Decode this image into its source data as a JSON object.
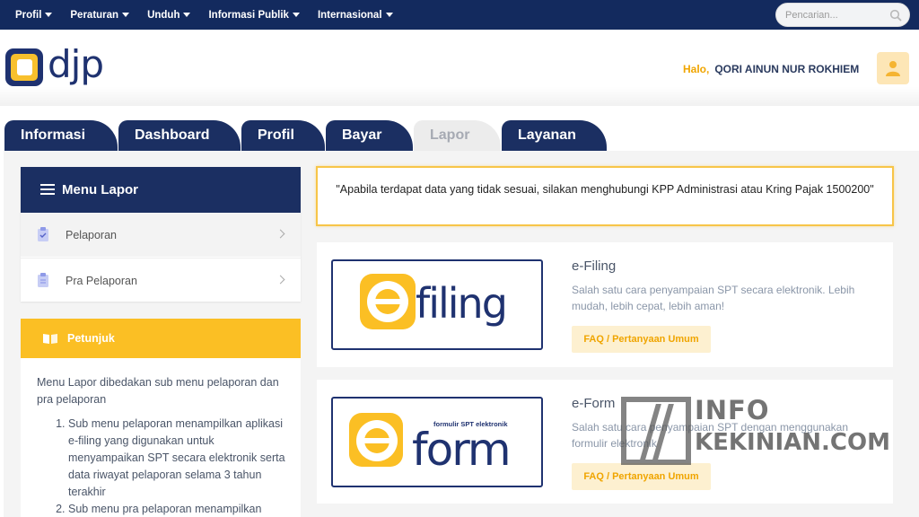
{
  "topnav": {
    "items": [
      "Profil",
      "Peraturan",
      "Unduh",
      "Informasi Publik",
      "Internasional"
    ],
    "search_placeholder": "Pencarian..."
  },
  "header": {
    "logo_text": "djp",
    "greeting": "Halo,",
    "user_name": "QORI AINUN NUR ROKHIEM"
  },
  "tabs": [
    {
      "label": "Informasi",
      "active": false
    },
    {
      "label": "Dashboard",
      "active": false
    },
    {
      "label": "Profil",
      "active": false
    },
    {
      "label": "Bayar",
      "active": false
    },
    {
      "label": "Lapor",
      "active": true
    },
    {
      "label": "Layanan",
      "active": false
    }
  ],
  "sidebar": {
    "menu_title": "Menu Lapor",
    "items": [
      {
        "label": "Pelaporan",
        "icon": "clipboard-check-icon"
      },
      {
        "label": "Pra Pelaporan",
        "icon": "clipboard-icon"
      }
    ],
    "petunjuk": {
      "title": "Petunjuk",
      "intro": "Menu Lapor dibedakan sub menu pelaporan dan pra pelaporan",
      "steps": [
        "Sub menu pelaporan menampilkan aplikasi e-filing yang digunakan untuk menyampaikan SPT secara elektronik serta data riwayat pelaporan selama 3 tahun terakhir",
        "Sub menu pra pelaporan menampilkan"
      ]
    }
  },
  "notice": "\"Apabila terdapat data yang tidak sesuai, silakan menghubungi KPP Administrasi atau Kring Pajak 1500200\"",
  "services": [
    {
      "logo_word": "filing",
      "title": "e-Filing",
      "description": "Salah satu cara penyampaian SPT secara elektronik. Lebih mudah, lebih cepat, lebih aman!",
      "faq": "FAQ / Pertanyaan Umum"
    },
    {
      "logo_word": "form",
      "logo_caption": "formulir SPT elektronik",
      "title": "e-Form",
      "description": "Salah satu cara penyampaian SPT dengan menggunakan formulir elektronik",
      "faq": "FAQ / Pertanyaan Umum"
    }
  ],
  "watermark": {
    "line1": "INFO",
    "line2": "KEKINIAN.COM"
  },
  "colors": {
    "navy": "#1b2f62",
    "accent": "#fbbf24",
    "faq_text": "#f0a500"
  }
}
